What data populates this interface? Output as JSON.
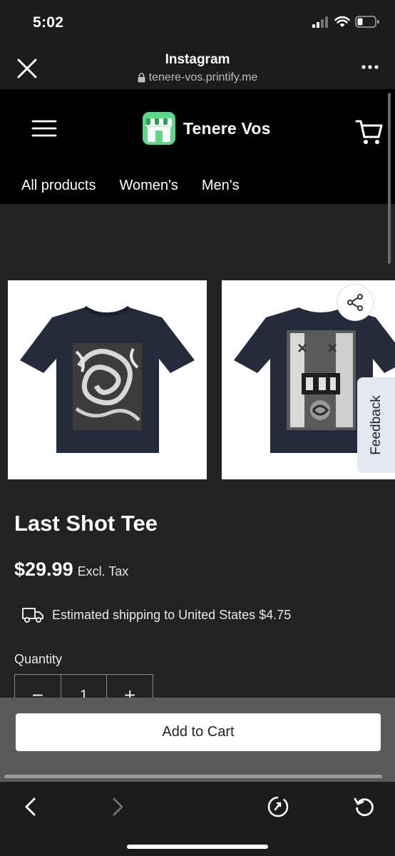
{
  "status_bar": {
    "time": "5:02"
  },
  "browser": {
    "title": "Instagram",
    "url": "tenere-vos.printify.me"
  },
  "store": {
    "name": "Tenere Vos",
    "categories": [
      "All products",
      "Women's",
      "Men's"
    ]
  },
  "product": {
    "title": "Last Shot Tee",
    "price": "$29.99",
    "tax_note": "Excl. Tax",
    "shipping": "Estimated shipping to United States $4.75",
    "quantity_label": "Quantity",
    "quantity_value": "1",
    "quantity_minus": "−",
    "quantity_plus": "+"
  },
  "feedback_label": "Feedback",
  "add_to_cart_label": "Add to Cart",
  "colors": {
    "accent_green": "#5fd68a",
    "nav_bg": "#000000",
    "page_bg": "#222222"
  }
}
